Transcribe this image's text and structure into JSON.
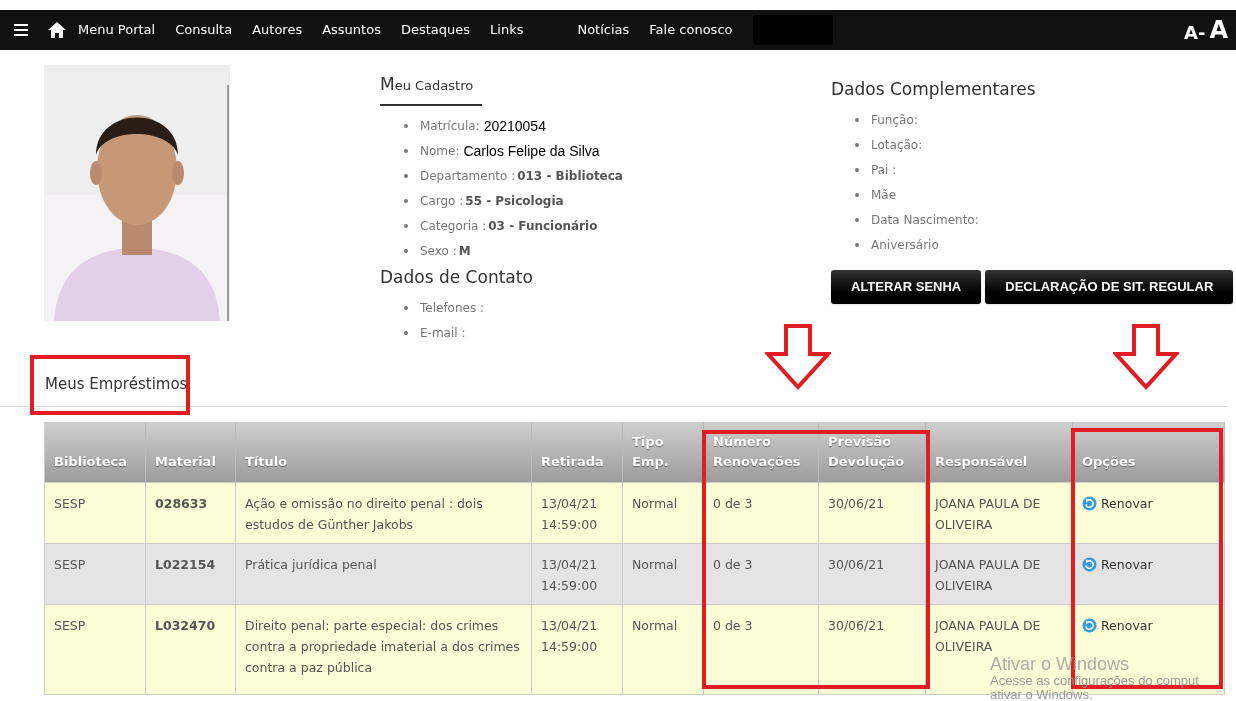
{
  "nav": {
    "items": [
      "Menu Portal",
      "Consulta",
      "Autores",
      "Assuntos",
      "Destaques",
      "Links",
      "Notícias",
      "Fale conosco"
    ],
    "font_controls": [
      "A-",
      "A"
    ]
  },
  "profile": {
    "photo": {
      "kind": "picture"
    },
    "cadastro": {
      "title": "Meu Cadastro",
      "fields": [
        {
          "label": "Matrícula:",
          "value": "20210054",
          "kind": "plain"
        },
        {
          "label": "Nome:",
          "value": "Carlos Felipe da Silva",
          "kind": "plain"
        },
        {
          "label": "Departamento :",
          "value": "013 - Biblioteca",
          "kind": "bold"
        },
        {
          "label": "Cargo :",
          "value": "55 - Psicologia",
          "kind": "bold"
        },
        {
          "label": "Categoria :",
          "value": "03 - Funcionário",
          "kind": "bold"
        },
        {
          "label": "Sexo :",
          "value": "M",
          "kind": "bold"
        }
      ]
    },
    "contato": {
      "title": "Dados de Contato",
      "fields": [
        "Telefones :",
        "E-mail :"
      ]
    },
    "complementares": {
      "title": "Dados Complementares",
      "fields": [
        "Função:",
        "Lotação:",
        "Pai :",
        "Mãe",
        "Data Nascimento:",
        "Aniversário"
      ]
    },
    "buttons": [
      "ALTERAR SENHA",
      "DECLARAÇÃO DE SIT. REGULAR"
    ]
  },
  "loans": {
    "title": "Meus Empréstimos",
    "table": {
      "columns": [
        "Biblioteca",
        "Material",
        "Título",
        "Retirada",
        "Tipo Emp.",
        "Número Renovações",
        "Previsão Devolução",
        "Responsável",
        "Opções"
      ],
      "rows": [
        {
          "biblioteca": "SESP",
          "material": "028633",
          "titulo": "Ação e omissão no direito penal : dois estudos de Günther Jakobs",
          "retirada": "13/04/21 14:59:00",
          "tipo": "Normal",
          "renovacoes": "0 de 3",
          "devolucao": "30/06/21",
          "responsavel": "JOANA PAULA DE OLIVEIRA",
          "action": "Renovar"
        },
        {
          "biblioteca": "SESP",
          "material": "L022154",
          "titulo": "Prática jurídica penal",
          "retirada": "13/04/21 14:59:00",
          "tipo": "Normal",
          "renovacoes": "0 de 3",
          "devolucao": "30/06/21",
          "responsavel": "JOANA PAULA DE OLIVEIRA",
          "action": "Renovar"
        },
        {
          "biblioteca": "SESP",
          "material": "L032470",
          "titulo": "Direito penal: parte especial: dos crimes contra a propriedade imaterial a dos crimes contra a paz pública",
          "retirada": "13/04/21 14:59:00",
          "tipo": "Normal",
          "renovacoes": "0 de 3",
          "devolucao": "30/06/21",
          "responsavel": "JOANA PAULA DE OLIVEIRA",
          "action": "Renovar"
        }
      ]
    }
  },
  "windows_activation": {
    "title": "Ativar o Windows",
    "lines": [
      "Acesse as configurações do comput",
      "ativar o Windows."
    ]
  }
}
